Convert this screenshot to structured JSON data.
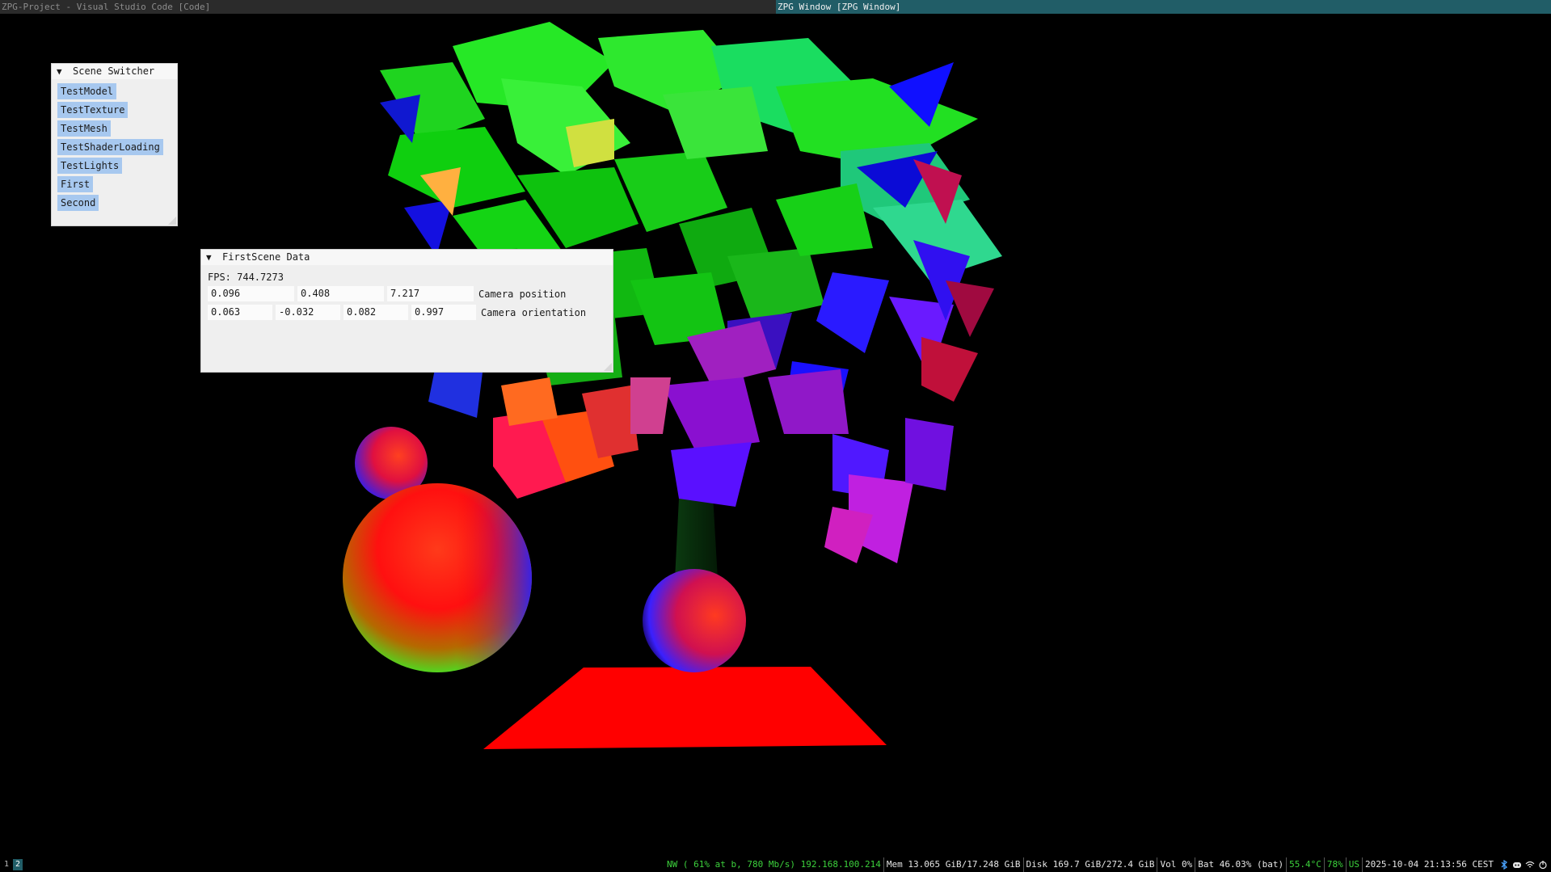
{
  "window_titles": {
    "left": "ZPG-Project - Visual Studio Code [Code]",
    "right": "ZPG Window [ZPG Window]"
  },
  "scene_switcher": {
    "title": "Scene Switcher",
    "buttons": [
      "TestModel",
      "TestTexture",
      "TestMesh",
      "TestShaderLoading",
      "TestLights",
      "First",
      "Second"
    ]
  },
  "scene_data": {
    "title": "FirstScene Data",
    "fps": "FPS: 744.7273",
    "camera_position": {
      "values": [
        "0.096",
        "0.408",
        "7.217"
      ],
      "label": "Camera position"
    },
    "camera_orientation": {
      "values": [
        "0.063",
        "-0.032",
        "0.082",
        "0.997"
      ],
      "label": "Camera orientation"
    }
  },
  "statusbar": {
    "workspaces": [
      "1",
      "2"
    ],
    "active_workspace": "2",
    "network": "NW ( 61% at b, 780 Mb/s) 192.168.100.214",
    "memory": "Mem 13.065 GiB/17.248 GiB",
    "disk": "Disk 169.7 GiB/272.4 GiB",
    "volume": "Vol 0%",
    "battery": "Bat 46.03% (bat)",
    "temperature": "55.4°C",
    "cpu": "78%",
    "keyboard": "US",
    "datetime": "2025-10-04 21:13:56 CEST",
    "tray_icons": [
      "bluetooth-icon",
      "discord-icon",
      "wifi-icon",
      "power-icon"
    ]
  },
  "colors": {
    "titlebar_left_bg": "#2b2b2b",
    "titlebar_right_bg": "#215d67",
    "imgui_bg": "#efefef",
    "imgui_button": "#a7c8ef",
    "status_green": "#3cd13c"
  }
}
